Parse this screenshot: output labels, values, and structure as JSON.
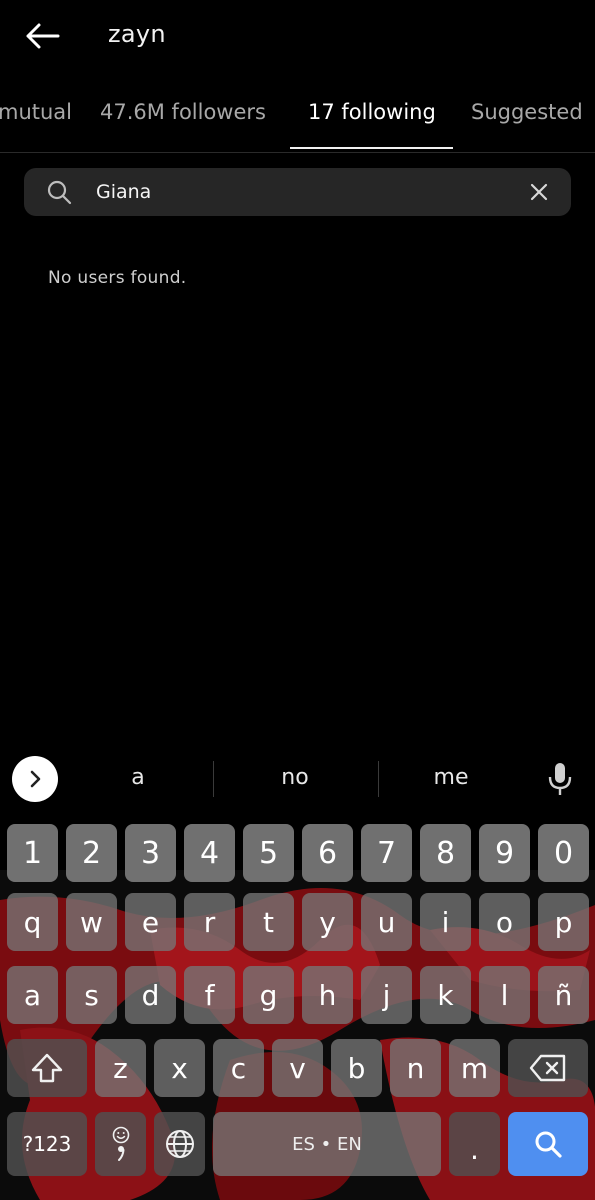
{
  "header": {
    "title": "zayn",
    "back_icon": "arrow-left-icon"
  },
  "tabs": [
    {
      "label": "mutual"
    },
    {
      "label": "47.6M followers"
    },
    {
      "label": "17 following",
      "active": true
    },
    {
      "label": "Suggested"
    }
  ],
  "search": {
    "value": "Giana",
    "placeholder": "",
    "icon": "search-icon",
    "clear_icon": "close-icon"
  },
  "results": {
    "empty_message": "No users found."
  },
  "keyboard": {
    "suggestions": [
      "a",
      "no",
      "me"
    ],
    "number_row": [
      "1",
      "2",
      "3",
      "4",
      "5",
      "6",
      "7",
      "8",
      "9",
      "0"
    ],
    "row1": [
      "q",
      "w",
      "e",
      "r",
      "t",
      "y",
      "u",
      "i",
      "o",
      "p"
    ],
    "row2": [
      "a",
      "s",
      "d",
      "f",
      "g",
      "h",
      "j",
      "k",
      "l",
      "ñ"
    ],
    "row3": [
      "z",
      "x",
      "c",
      "v",
      "b",
      "n",
      "m"
    ],
    "symbols_label": "?123",
    "space_label": "ES • EN",
    "period_label": ".",
    "accent_color": "#4f8ff0"
  }
}
